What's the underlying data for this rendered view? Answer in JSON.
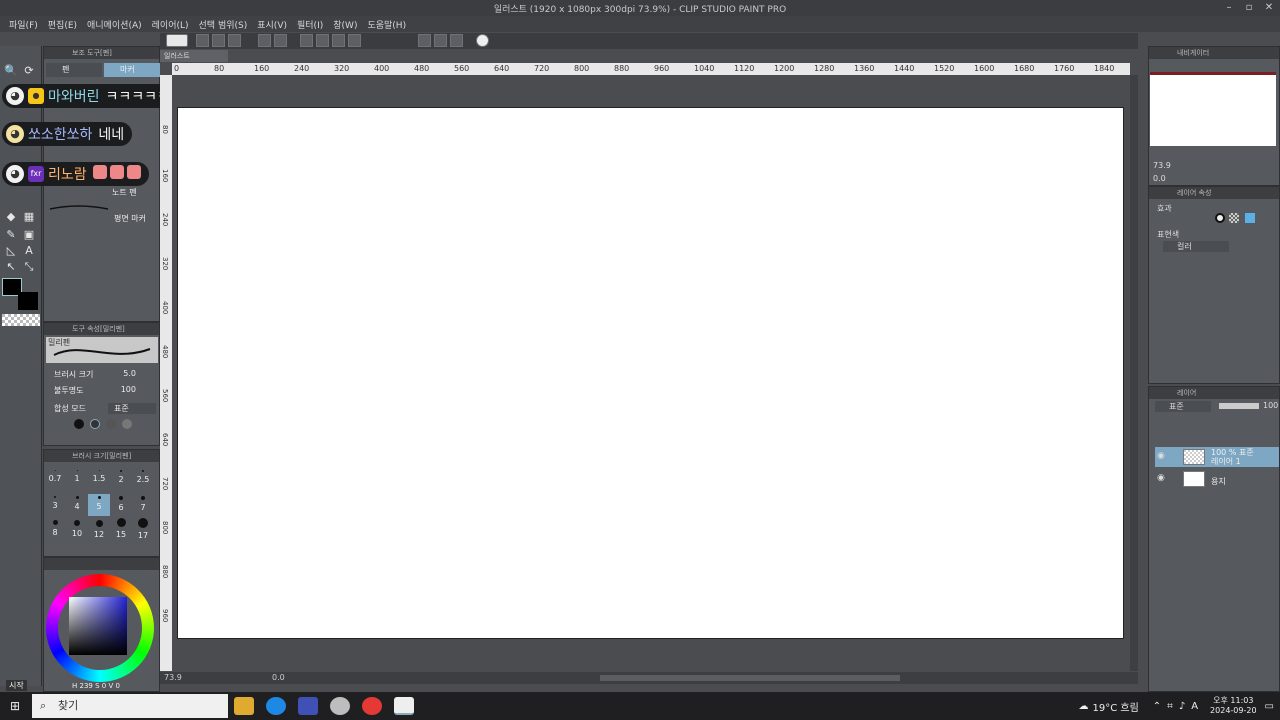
{
  "titlebar": {
    "title": "일러스트 (1920 x 1080px 300dpi 73.9%) - CLIP STUDIO PAINT PRO"
  },
  "menubar": {
    "items": [
      "파일(F)",
      "편집(E)",
      "애니메이션(A)",
      "레이어(L)",
      "선택 범위(S)",
      "표시(V)",
      "필터(I)",
      "창(W)",
      "도움말(H)"
    ]
  },
  "subtool": {
    "title": "보조 도구[펜]",
    "tabs": [
      "펜",
      "마커"
    ],
    "brushes": [
      "노트 펜",
      "평면 마커"
    ]
  },
  "toolprop": {
    "title": "도구 속성[밀리펜]",
    "brush_name": "밀리펜",
    "brush_size_label": "브러시 크기",
    "brush_size_value": "5.0",
    "opacity_label": "불투명도",
    "opacity_value": "100",
    "blend_label": "합성 모드",
    "blend_value": "표준"
  },
  "brushsize": {
    "title": "브러시 크기[밀리펜]",
    "sizes": [
      "0.7",
      "1",
      "1.5",
      "2",
      "2.5",
      "3",
      "4",
      "5",
      "6",
      "7",
      "8",
      "10",
      "12",
      "15",
      "17"
    ],
    "selected": "5"
  },
  "colorpanel": {
    "readout_h": "H 239 S",
    "readout_v": "0 V",
    "readout_end": "0"
  },
  "chat": [
    {
      "nick": "마와버린",
      "message": "ㅋㅋㅋㅋㅋㅋ",
      "nick_color": "#8fd9e8"
    },
    {
      "nick": "쏘소한쏘하",
      "message": "네네",
      "nick_color": "#a9b8ff"
    },
    {
      "nick": "리노람",
      "message": "",
      "nick_color": "#ffb36b",
      "badge": "fxr"
    }
  ],
  "canvas": {
    "doc_tab": "일러스트",
    "ruler_marks": [
      "0",
      "80",
      "160",
      "240",
      "320",
      "400",
      "480",
      "560",
      "640",
      "720",
      "800",
      "880",
      "960",
      "1040",
      "1120",
      "1200",
      "1280",
      "1360",
      "1440",
      "1520",
      "1600",
      "1680",
      "1760",
      "1840"
    ],
    "ruler_left_marks": [
      "80",
      "160",
      "240",
      "320",
      "400",
      "480",
      "560",
      "640",
      "720",
      "800",
      "880",
      "960"
    ],
    "zoom": "73.9",
    "angle": "0.0"
  },
  "navigator": {
    "title": "내비게이터",
    "zoom": "73.9",
    "angle": "0.0"
  },
  "layerprop": {
    "title": "레이어 속성",
    "effect_label": "효과",
    "expression_label": "표현색",
    "expression_value": "컬러"
  },
  "layers": {
    "title": "레이어",
    "blend": "표준",
    "opacity": "100",
    "items": [
      {
        "line1": "100 % 표준",
        "line2": "레이어 1"
      },
      {
        "line1": "",
        "line2": "용지"
      }
    ]
  },
  "taskbar": {
    "search_placeholder": "찾기",
    "start_label": "시작",
    "weather": "19°C 흐림",
    "ime": "A",
    "time": "오후 11:03",
    "date": "2024-09-20"
  }
}
